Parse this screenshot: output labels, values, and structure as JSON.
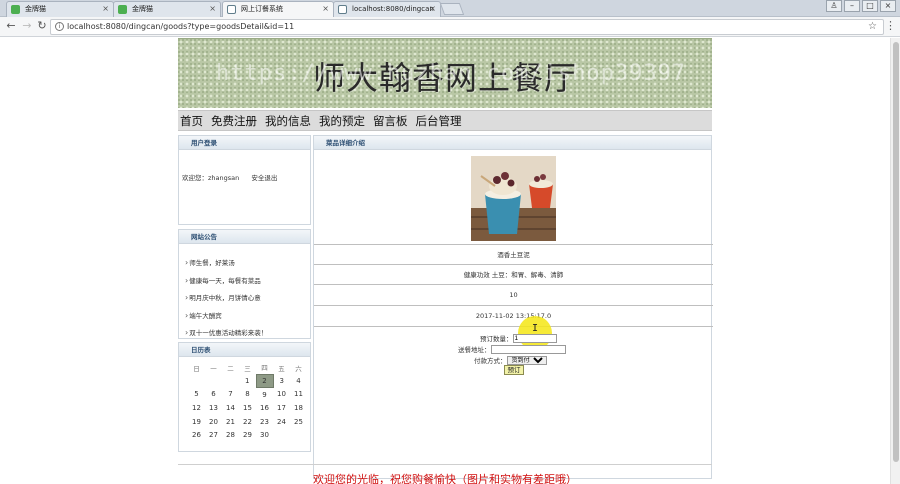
{
  "browser": {
    "tabs": [
      {
        "title": "金牌猫",
        "color": "#4caf50"
      },
      {
        "title": "金牌猫",
        "color": "#4caf50"
      },
      {
        "title": "网上订餐系统",
        "color": "#607d8b"
      },
      {
        "title": "localhost:8080/dingcan",
        "color": "#607d8b"
      }
    ],
    "url": "localhost:8080/dingcan/goods?type=goodsDetail&id=11"
  },
  "site": {
    "title": "师大翰香网上餐厅",
    "watermark": "https://www.huzhan.com/ishop39397",
    "nav": [
      "首页",
      "免费注册",
      "我的信息",
      "我的预定",
      "留言板",
      "后台管理"
    ]
  },
  "login": {
    "heading": "用户登录",
    "welcome": "欢迎您：zhangsan",
    "logout": "安全退出"
  },
  "notices": {
    "heading": "网站公告",
    "items": [
      "师生餐，好莱汤",
      "健康每一天，每餐有菜品",
      "明月庆中秋，月饼情心意",
      "端午大酬宾",
      "双十一优惠活动精彩来袭！"
    ]
  },
  "calendar": {
    "heading": "日历表",
    "weekdays": [
      "日",
      "一",
      "二",
      "三",
      "四",
      "五",
      "六"
    ],
    "weeks": [
      [
        "",
        "",
        "",
        "1",
        "2",
        "3",
        "4"
      ],
      [
        "5",
        "6",
        "7",
        "8",
        "9",
        "10",
        "11"
      ],
      [
        "12",
        "13",
        "14",
        "15",
        "16",
        "17",
        "18"
      ],
      [
        "19",
        "20",
        "21",
        "22",
        "23",
        "24",
        "25"
      ],
      [
        "26",
        "27",
        "28",
        "29",
        "30",
        "",
        ""
      ]
    ],
    "today": "2"
  },
  "detail": {
    "heading": "菜品详细介绍",
    "name": "酒香土豆泥",
    "effect": "健康功效 土豆：和胃、解毒、清肺",
    "price": "10",
    "date": "2017-11-02 13:15:17.0",
    "form": {
      "quantity_label": "预订数量：",
      "quantity_value": "1",
      "address_label": "送餐地址：",
      "address_value": "",
      "payment_label": "付款方式：",
      "payment_value": "货到付款",
      "submit_label": "预订"
    }
  },
  "footer": {
    "text": "欢迎您的光临，祝您购餐愉快（图片和实物有差距哦）"
  }
}
